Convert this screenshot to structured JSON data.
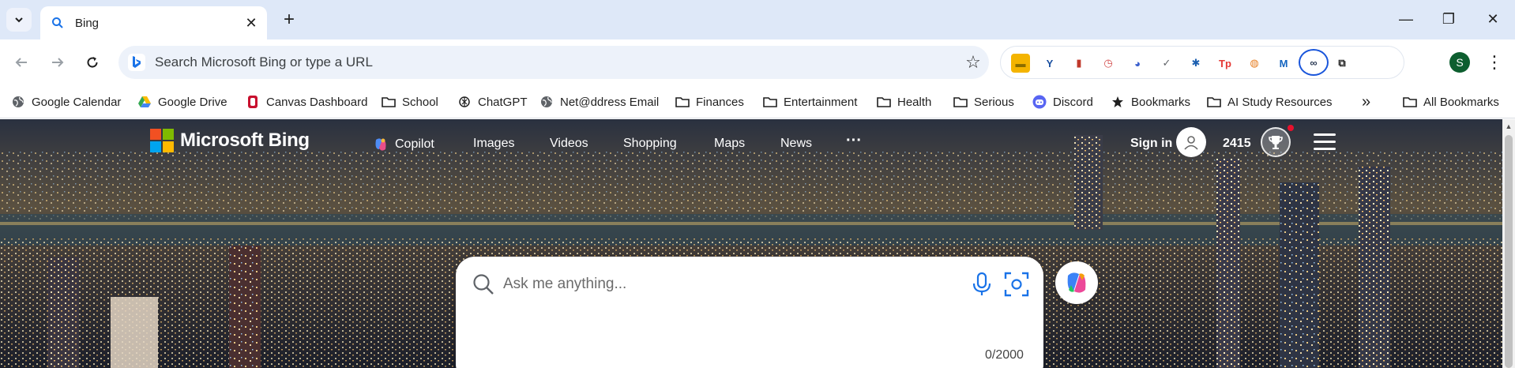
{
  "browser": {
    "tab": {
      "title": "Bing",
      "close_symbol": "✕"
    },
    "new_tab_symbol": "+",
    "window_controls": {
      "minimize": "—",
      "restore": "❐",
      "close": "✕"
    },
    "omnibox": {
      "placeholder": "Search Microsoft Bing or type a URL"
    },
    "profile_initial": "S",
    "menu_symbol": "⋮",
    "extensions": [
      {
        "icon": "sticky-note-icon",
        "glyph": "▬",
        "color": "#f4b400",
        "fg": "#8a6d00"
      },
      {
        "icon": "y-tree-icon",
        "glyph": "Y",
        "color": "#ffffff",
        "fg": "#1a4fa0"
      },
      {
        "icon": "red-book-icon",
        "glyph": "▮",
        "color": "#ffffff",
        "fg": "#c0392b"
      },
      {
        "icon": "clock-icon",
        "glyph": "◷",
        "color": "#ffffff",
        "fg": "#d24a4a"
      },
      {
        "icon": "pie-icon",
        "glyph": "◕",
        "color": "#ffffff",
        "fg": "#3a5fcd"
      },
      {
        "icon": "check-circle-icon",
        "glyph": "✓",
        "color": "#ffffff",
        "fg": "#5f6368"
      },
      {
        "icon": "soccer-icon",
        "glyph": "✱",
        "color": "#ffffff",
        "fg": "#1b5fb0"
      },
      {
        "icon": "tp-icon",
        "glyph": "Tp",
        "color": "#ffffff",
        "fg": "#e53935"
      },
      {
        "icon": "fox-icon",
        "glyph": "◍",
        "color": "#ffffff",
        "fg": "#e67e22"
      },
      {
        "icon": "m-logo-icon",
        "glyph": "M",
        "color": "#ffffff",
        "fg": "#1565c0"
      },
      {
        "icon": "circled-glasses-icon",
        "glyph": "∞",
        "color": "#ffffff",
        "fg": "#2b3a55"
      },
      {
        "icon": "puzzle-icon",
        "glyph": "⧉",
        "color": "#ffffff",
        "fg": "#1f1f1f"
      }
    ]
  },
  "bookmarks": [
    {
      "label": "Google Calendar",
      "icon": "globe-icon"
    },
    {
      "label": "Google Drive",
      "icon": "drive-icon"
    },
    {
      "label": "Canvas Dashboard",
      "icon": "canvas-icon"
    },
    {
      "label": "School",
      "icon": "folder-icon"
    },
    {
      "label": "ChatGPT",
      "icon": "chatgpt-icon"
    },
    {
      "label": "Net@ddress Email",
      "icon": "globe-icon"
    },
    {
      "label": "Finances",
      "icon": "folder-icon"
    },
    {
      "label": "Entertainment",
      "icon": "folder-icon"
    },
    {
      "label": "Health",
      "icon": "folder-icon"
    },
    {
      "label": "Serious",
      "icon": "folder-icon"
    },
    {
      "label": "Discord",
      "icon": "discord-icon"
    },
    {
      "label": "Bookmarks",
      "icon": "star-icon"
    },
    {
      "label": "AI Study Resources",
      "icon": "folder-icon"
    }
  ],
  "bookmarks_overflow": "»",
  "all_bookmarks_label": "All Bookmarks",
  "bing": {
    "logo_text": "Microsoft Bing",
    "nav": [
      "Copilot",
      "Images",
      "Videos",
      "Shopping",
      "Maps",
      "News"
    ],
    "more_symbol": "···",
    "sign_in": "Sign in",
    "points": "2415",
    "search_placeholder": "Ask me anything...",
    "char_counter": "0/2000"
  }
}
